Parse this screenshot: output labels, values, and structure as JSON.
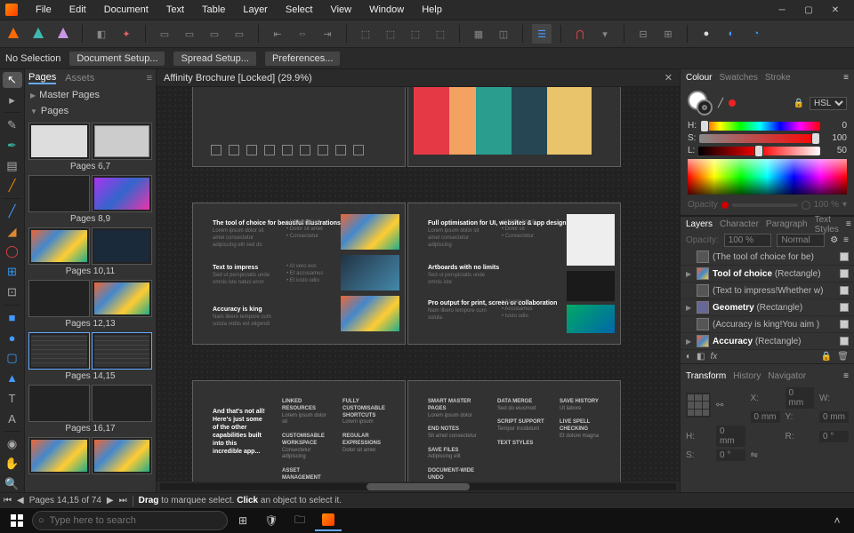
{
  "menu": {
    "items": [
      "File",
      "Edit",
      "Document",
      "Text",
      "Table",
      "Layer",
      "Select",
      "View",
      "Window",
      "Help"
    ]
  },
  "contextbar": {
    "no_selection": "No Selection",
    "doc_setup": "Document Setup...",
    "spread_setup": "Spread Setup...",
    "prefs": "Preferences..."
  },
  "doctab": {
    "title": "Affinity Brochure [Locked] (29.9%)"
  },
  "pages_panel": {
    "tabs": [
      "Pages",
      "Assets"
    ],
    "master": "Master Pages",
    "pages_label": "Pages",
    "spreads": [
      {
        "caption": "Pages 6,7"
      },
      {
        "caption": "Pages 8,9"
      },
      {
        "caption": "Pages 10,11"
      },
      {
        "caption": "Pages 12,13"
      },
      {
        "caption": "Pages 14,15",
        "selected": true
      },
      {
        "caption": "Pages 16,17"
      }
    ]
  },
  "color_panel": {
    "tabs": [
      "Colour",
      "Swatches",
      "Stroke"
    ],
    "mode": "HSL",
    "h": {
      "label": "H:",
      "value": "0"
    },
    "s": {
      "label": "S:",
      "value": "100"
    },
    "l": {
      "label": "L:",
      "value": "50"
    },
    "opacity_label": "Opacity",
    "opacity_value": "100 %"
  },
  "layers_panel": {
    "tabs": [
      "Layers",
      "Character",
      "Paragraph",
      "Text Styles"
    ],
    "opacity_label": "Opacity:",
    "opacity_value": "100 %",
    "blend": "Normal",
    "layers": [
      {
        "name": "(The tool of choice for be)",
        "bold": false
      },
      {
        "name": "Tool of choice",
        "suffix": "(Rectangle)",
        "bold": true,
        "expand": true,
        "color": true
      },
      {
        "name": "(Text to impress!Whether w)",
        "bold": false
      },
      {
        "name": "Geometry",
        "suffix": "(Rectangle)",
        "bold": true,
        "expand": true
      },
      {
        "name": "(Accuracy is king!You aim )",
        "bold": false
      },
      {
        "name": "Accuracy",
        "suffix": "(Rectangle)",
        "bold": true,
        "expand": true,
        "color": true
      }
    ]
  },
  "transform_panel": {
    "tabs": [
      "Transform",
      "History",
      "Navigator"
    ],
    "x": {
      "label": "X:",
      "value": "0 mm"
    },
    "y": {
      "label": "Y:",
      "value": "0 mm"
    },
    "w": {
      "label": "W:",
      "value": "0 mm"
    },
    "h": {
      "label": "H:",
      "value": "0 mm"
    },
    "r": {
      "label": "R:",
      "value": "0 °"
    },
    "s": {
      "label": "S:",
      "value": "0 °"
    }
  },
  "status": {
    "pages": "Pages 14,15 of 74",
    "hint_drag": "Drag",
    "hint_drag2": " to marquee select. ",
    "hint_click": "Click",
    "hint_click2": " an object to select it."
  },
  "taskbar": {
    "search_placeholder": "Type here to search"
  },
  "spreads_content": {
    "s2_left": {
      "h1": "The tool of choice for beautiful illustrations",
      "h2": "Text to impress",
      "h3": "Accuracy is king"
    },
    "s2_right": {
      "h1": "Full optimisation for UI, websites & app design",
      "h2": "Artboards with no limits",
      "h3": "Pro output for print, screen or collaboration"
    },
    "s3_left": {
      "h1": "And that's not all! Here's just some of the other capabilities built into this incredible app..."
    }
  }
}
